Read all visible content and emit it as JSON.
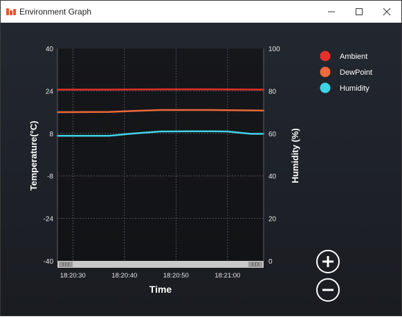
{
  "window": {
    "title": "Environment Graph"
  },
  "legend": [
    {
      "label": "Ambient",
      "color": "#e8302a"
    },
    {
      "label": "DewPoint",
      "color": "#ee6a3a"
    },
    {
      "label": "Humidity",
      "color": "#3fd3e6"
    }
  ],
  "controls": {
    "zoom_in_icon": "plus-circle-icon",
    "zoom_out_icon": "minus-circle-icon"
  },
  "chart_data": {
    "type": "line",
    "xlabel": "Time",
    "ylabel_left": "Temperature(°C)",
    "ylabel_right": "Humidity (%)",
    "ylim_left": [
      -40,
      40
    ],
    "ylim_right": [
      0,
      100
    ],
    "yticks_left": [
      40,
      24,
      8,
      -8,
      -24,
      -40
    ],
    "yticks_right": [
      100,
      80,
      60,
      40,
      20,
      0
    ],
    "x_tick_labels": [
      "18:20:30",
      "18:20:40",
      "18:20:50",
      "18:21:00"
    ],
    "x_tick_seconds": [
      30,
      40,
      50,
      60
    ],
    "xlim_seconds": [
      27,
      67
    ],
    "grid": true,
    "legend_position": "right",
    "series": [
      {
        "name": "Ambient",
        "axis": "left",
        "color": "#e8302a",
        "x": [
          27,
          37,
          47,
          57,
          67
        ],
        "y": [
          24.5,
          24.5,
          24.6,
          24.6,
          24.5
        ]
      },
      {
        "name": "DewPoint",
        "axis": "left",
        "color": "#ee6a3a",
        "x": [
          27,
          37,
          42,
          47,
          57,
          67
        ],
        "y": [
          16.0,
          16.1,
          16.5,
          16.8,
          16.8,
          16.6
        ]
      },
      {
        "name": "Humidity",
        "axis": "right",
        "color": "#3fd3e6",
        "x": [
          27,
          29,
          37,
          38.5,
          41,
          44,
          47,
          52,
          57,
          60,
          63,
          64.5,
          67
        ],
        "y": [
          58.9,
          58.9,
          58.9,
          59.2,
          59.8,
          60.4,
          60.9,
          61.0,
          61.0,
          60.9,
          60.2,
          59.8,
          59.8
        ]
      }
    ]
  }
}
